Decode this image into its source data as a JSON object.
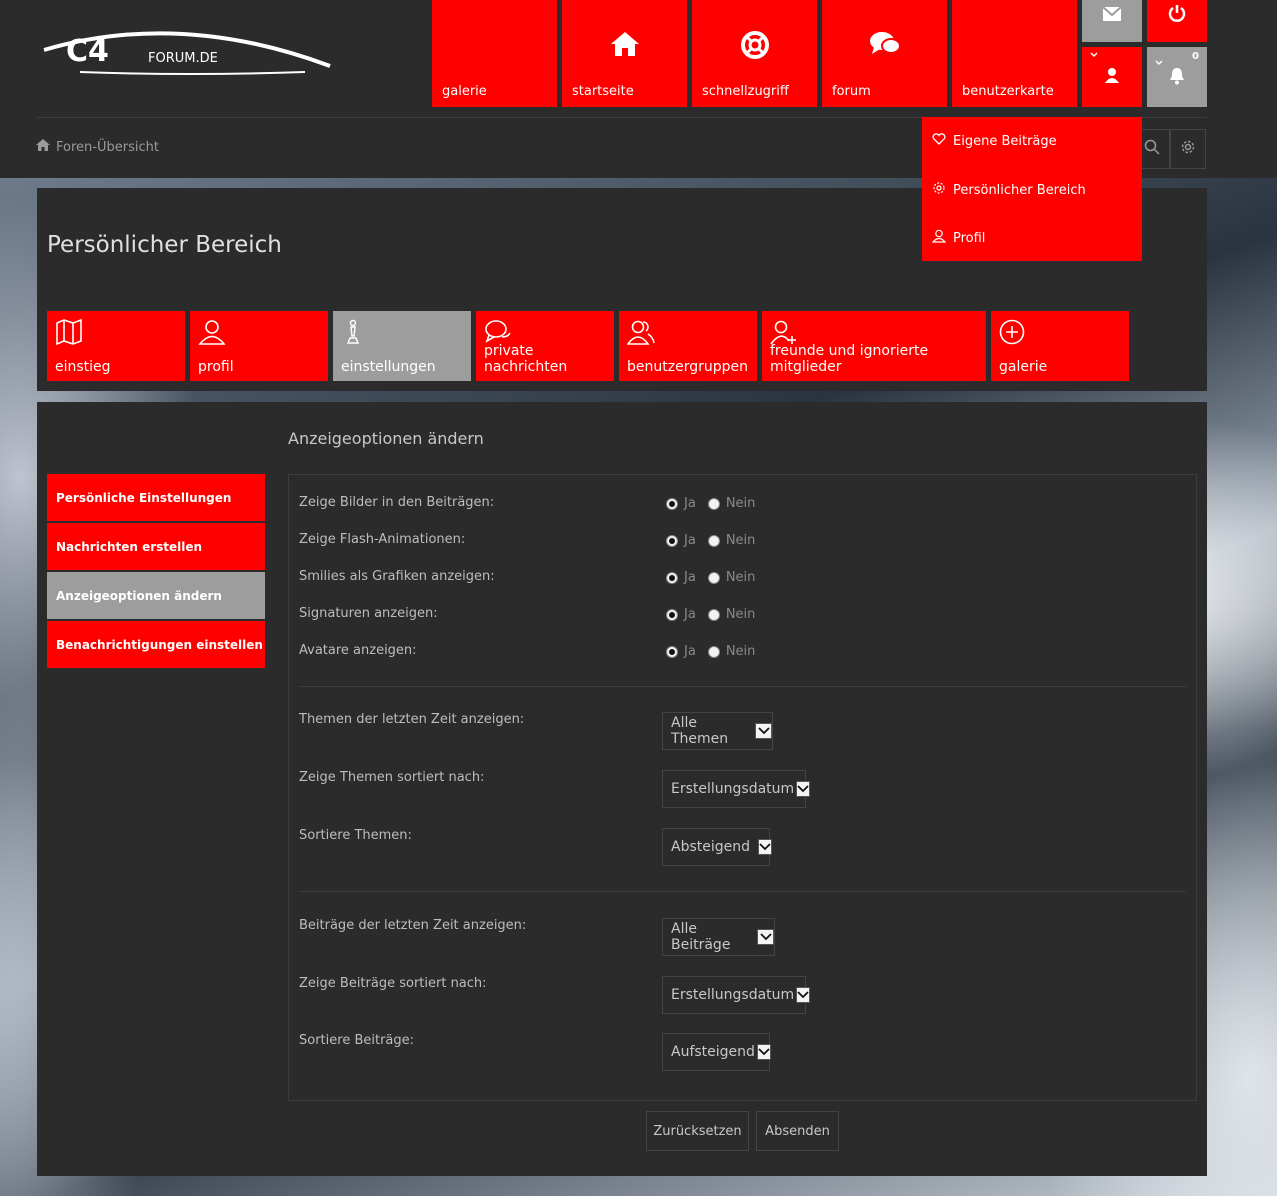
{
  "logo": {
    "mark": "C4",
    "domain": "FORUM.DE"
  },
  "top_tiles": [
    {
      "label": "galerie",
      "icon": "none"
    },
    {
      "label": "startseite",
      "icon": "home-icon"
    },
    {
      "label": "schnellzugriff",
      "icon": "lifebuoy-icon"
    },
    {
      "label": "forum",
      "icon": "chat-bubbles-icon"
    },
    {
      "label": "benutzerkarte",
      "icon": "none"
    }
  ],
  "notification_count": "0",
  "breadcrumb": {
    "label": "Foren-Übersicht"
  },
  "user_dropdown": [
    {
      "label": "Eigene Beiträge",
      "icon": "heart-icon"
    },
    {
      "label": "Persönlicher Bereich",
      "icon": "gear-icon"
    },
    {
      "label": "Profil",
      "icon": "user-icon"
    }
  ],
  "page_title": "Persönlicher Bereich",
  "nav_tiles": [
    {
      "label": "einstieg",
      "icon": "map-icon"
    },
    {
      "label": "profil",
      "icon": "user-icon"
    },
    {
      "label": "einstellungen",
      "icon": "chess-icon",
      "active": true
    },
    {
      "label": "private nachrichten",
      "icon": "chat-icon"
    },
    {
      "label": "benutzergruppen",
      "icon": "users-icon"
    },
    {
      "label": "freunde und ignorierte mitglieder",
      "icon": "add-user-icon"
    },
    {
      "label": "galerie",
      "icon": "plus-circle-icon"
    }
  ],
  "side_menu": [
    {
      "label": "Persönliche Einstellungen"
    },
    {
      "label": "Nachrichten erstellen"
    },
    {
      "label": "Anzeigeoptionen ändern",
      "active": true
    },
    {
      "label": "Benachrichtigungen einstellen"
    }
  ],
  "form": {
    "title": "Anzeigeoptionen ändern",
    "yes_label": "Ja",
    "no_label": "Nein",
    "radio_options": [
      {
        "label": "Zeige Bilder in den Beiträgen:",
        "value": "Ja"
      },
      {
        "label": "Zeige Flash-Animationen:",
        "value": "Ja"
      },
      {
        "label": "Smilies als Grafiken anzeigen:",
        "value": "Ja"
      },
      {
        "label": "Signaturen anzeigen:",
        "value": "Ja"
      },
      {
        "label": "Avatare anzeigen:",
        "value": "Ja"
      }
    ],
    "topic_selects": [
      {
        "label": "Themen der letzten Zeit anzeigen:",
        "value": "Alle Themen"
      },
      {
        "label": "Zeige Themen sortiert nach:",
        "value": "Erstellungsdatum"
      },
      {
        "label": "Sortiere Themen:",
        "value": "Absteigend"
      }
    ],
    "post_selects": [
      {
        "label": "Beiträge der letzten Zeit anzeigen:",
        "value": "Alle Beiträge"
      },
      {
        "label": "Zeige Beiträge sortiert nach:",
        "value": "Erstellungsdatum"
      },
      {
        "label": "Sortiere Beiträge:",
        "value": "Aufsteigend"
      }
    ],
    "reset_label": "Zurücksetzen",
    "submit_label": "Absenden"
  },
  "colors": {
    "accent": "#ff0000",
    "active": "#9d9d9d",
    "panel": "#2b2b2b"
  }
}
